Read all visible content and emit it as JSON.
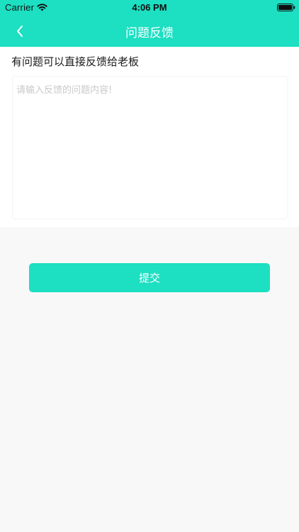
{
  "status_bar": {
    "carrier": "Carrier",
    "time": "4:06 PM",
    "icons": [
      "wifi-icon",
      "battery-icon"
    ]
  },
  "nav": {
    "title": "问题反馈",
    "back_icon": "chevron-left-icon"
  },
  "form": {
    "prompt": "有问题可以直接反馈给老板",
    "placeholder": "请输入反馈的问题内容!",
    "value": ""
  },
  "submit_label": "提交",
  "colors": {
    "accent": "#1ddfc2",
    "background": "#f8f8f8",
    "panel": "#ffffff"
  }
}
